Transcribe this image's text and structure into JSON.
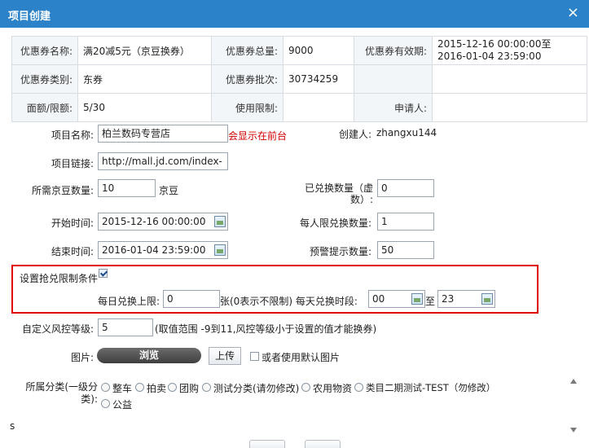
{
  "window": {
    "title": "项目创建",
    "close_label": "×"
  },
  "info_table": {
    "rows": [
      [
        {
          "k": "优惠券名称:",
          "v": "满20减5元（京豆换券）"
        },
        {
          "k": "优惠券总量:",
          "v": "9000"
        },
        {
          "k": "优惠券有效期:",
          "v": "2015-12-16 00:00:00至"
        }
      ],
      [
        {
          "k": "优惠券类别:",
          "v": "东券"
        },
        {
          "k": "优惠券批次:",
          "v": "30734259"
        },
        {
          "k": "",
          "v": ""
        }
      ],
      [
        {
          "k": "面额/限额:",
          "v": "5/30"
        },
        {
          "k": "使用限制:",
          "v": ""
        },
        {
          "k": "申请人:",
          "v": ""
        }
      ]
    ],
    "validity_line2": "2016-01-04 23:59:00"
  },
  "form": {
    "project_name": {
      "label": "项目名称:",
      "value": "柏兰数码专营店",
      "note": "会显示在前台"
    },
    "creator": {
      "label": "创建人:",
      "value": "zhangxu144"
    },
    "project_link": {
      "label": "项目链接:",
      "value": "http://mall.jd.com/index-"
    },
    "beans": {
      "label": "所需京豆数量:",
      "value": "10",
      "unit": "京豆"
    },
    "redeemed": {
      "label": "已兑换数量（虚数）:",
      "value": "0"
    },
    "start_time": {
      "label": "开始时间:",
      "value": "2015-12-16 00:00:00"
    },
    "per_person": {
      "label": "每人限兑换数量:",
      "value": "1"
    },
    "end_time": {
      "label": "结束时间:",
      "value": "2016-01-04 23:59:00"
    },
    "warning": {
      "label": "预警提示数量:",
      "value": "50"
    },
    "limit_section": {
      "label": "设置抢兑限制条件",
      "checked": true,
      "daily_limit_label": "每日兑换上限:",
      "daily_limit_value": "0",
      "daily_limit_note": "张(0表示不限制) 每天兑换时段:",
      "from_value": "00",
      "to_label": "至",
      "to_value": "23"
    },
    "risk": {
      "label": "自定义风控等级:",
      "value": "5",
      "note": "(取值范围 -9到11,风控等级小于设置的值才能换券)"
    },
    "image": {
      "label": "图片:",
      "browse_label": "浏览",
      "upload_label": "上传",
      "default_label": "或者使用默认图片"
    },
    "category": {
      "label": "所属分类(一级分类):",
      "options": [
        "整车",
        "拍卖",
        "团购",
        "测试分类(请勿修改)",
        "农用物资",
        "类目二期测试-TEST（勿修改）",
        "公益"
      ]
    },
    "footer_s": "s"
  }
}
